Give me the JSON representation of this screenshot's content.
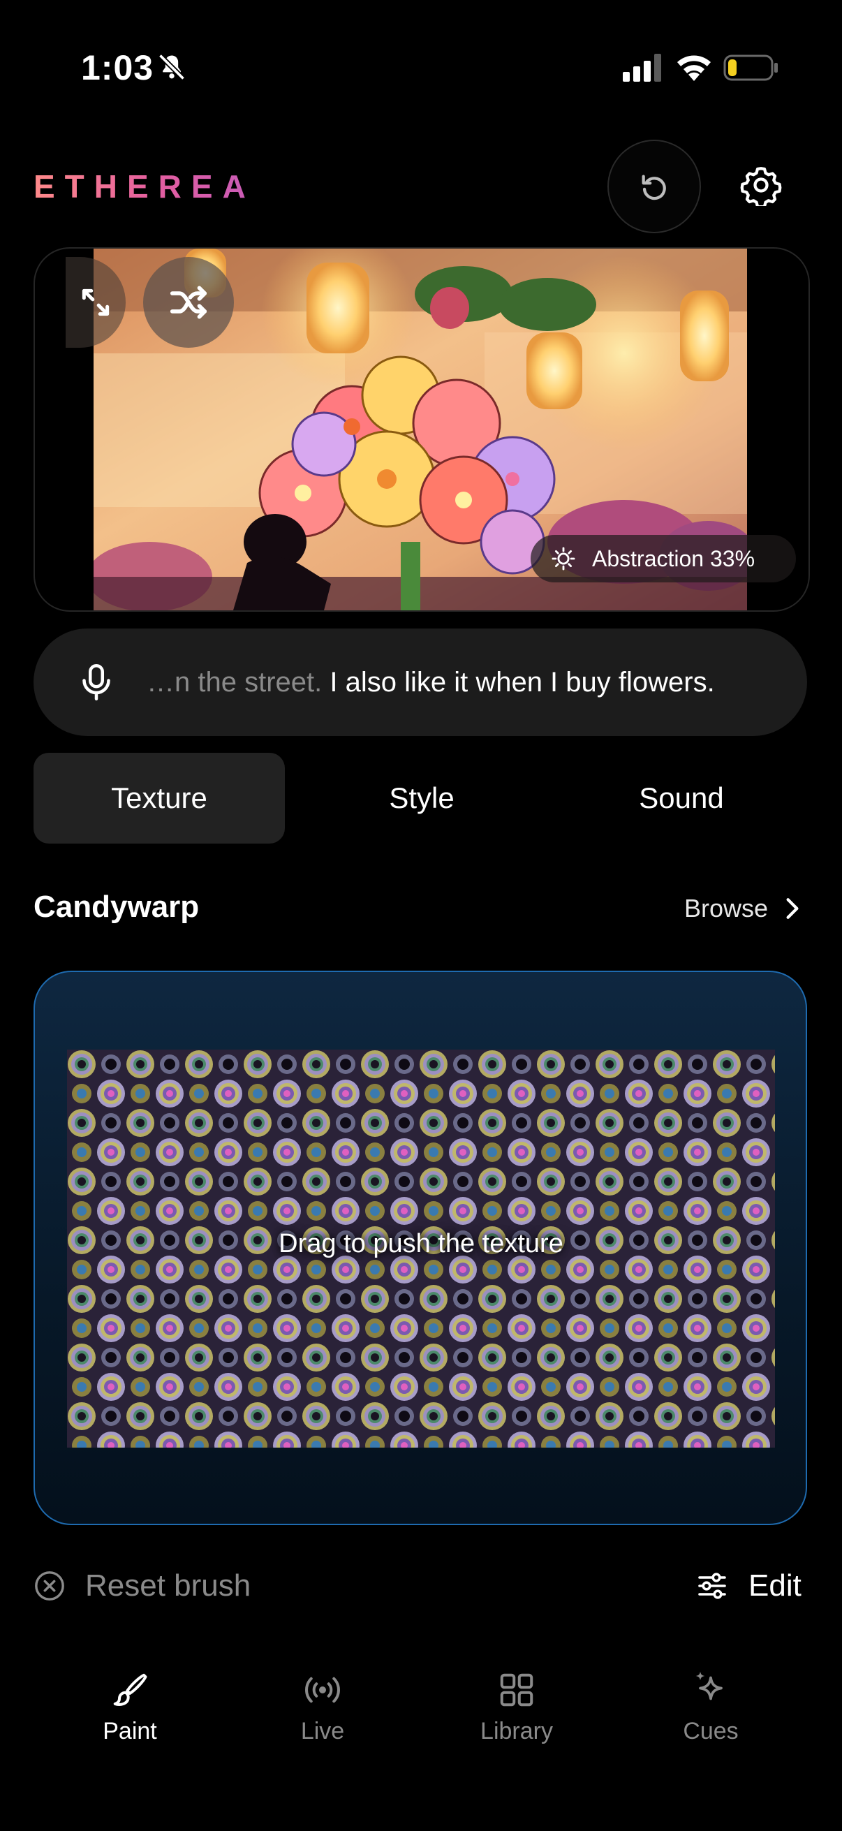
{
  "status_bar": {
    "time": "1:03"
  },
  "header": {
    "logo": "ETHEREA"
  },
  "preview": {
    "abstraction_label": "Abstraction 33%"
  },
  "transcript": {
    "faded_text": "…n the street.",
    "active_text": " I also like it when I buy flowers."
  },
  "tabs": [
    {
      "label": "Texture",
      "active": true
    },
    {
      "label": "Style",
      "active": false
    },
    {
      "label": "Sound",
      "active": false
    }
  ],
  "brush": {
    "name": "Candywarp",
    "browse_label": "Browse",
    "hint": "Drag to push the texture"
  },
  "controls": {
    "reset_label": "Reset brush",
    "edit_label": "Edit"
  },
  "nav": [
    {
      "label": "Paint",
      "icon": "brush-icon",
      "active": true
    },
    {
      "label": "Live",
      "icon": "broadcast-icon",
      "active": false
    },
    {
      "label": "Library",
      "icon": "grid-icon",
      "active": false
    },
    {
      "label": "Cues",
      "icon": "sparkle-icon",
      "active": false
    }
  ],
  "colors": {
    "accent_border": "#1e6bb0",
    "battery_fill": "#f5d020",
    "logo_gradient_start": "#ff8a8a",
    "logo_gradient_end": "#c85bb8"
  }
}
